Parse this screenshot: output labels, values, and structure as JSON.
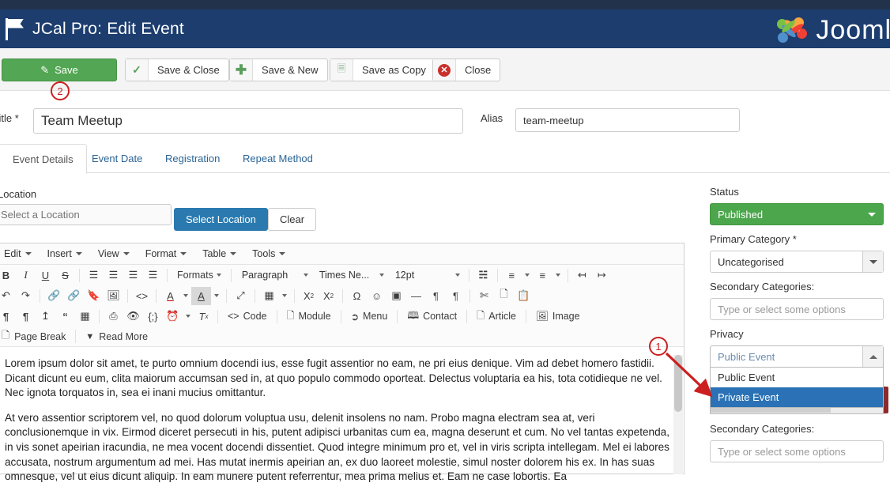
{
  "header": {
    "title": "JCal Pro: Edit Event",
    "flag_icon": "flag-icon",
    "brand": "Joomla",
    "brand_mark_icon": "joomla-logo-icon"
  },
  "toolbar": {
    "save_label": "Save",
    "save_icon": "pencil-square-icon",
    "save_close_label": "Save & Close",
    "save_close_icon": "check-icon",
    "save_new_label": "Save & New",
    "save_new_icon": "plus-icon",
    "save_copy_label": "Save as Copy",
    "save_copy_icon": "copy-icon",
    "close_label": "Close",
    "close_icon": "circle-x-icon"
  },
  "form": {
    "title_label": "Title *",
    "title_value": "Team Meetup",
    "alias_label": "Alias",
    "alias_value": "team-meetup"
  },
  "tabs": [
    {
      "label": "Event Details",
      "active": true
    },
    {
      "label": "Event Date",
      "active": false
    },
    {
      "label": "Registration",
      "active": false
    },
    {
      "label": "Repeat Method",
      "active": false
    }
  ],
  "location": {
    "label": "Location",
    "input_placeholder": "Select a Location",
    "select_button": "Select Location",
    "clear_button": "Clear"
  },
  "editor": {
    "menus": [
      "Edit",
      "Insert",
      "View",
      "Format",
      "Table",
      "Tools"
    ],
    "row1": {
      "bold": "B",
      "italic": "I",
      "underline": "U",
      "strikethrough": "S",
      "align_left_icon": "align-left-icon",
      "align_center_icon": "align-center-icon",
      "align_right_icon": "align-right-icon",
      "align_justify_icon": "align-justify-icon",
      "formats_label": "Formats",
      "paragraph_label": "Paragraph",
      "font_label": "Times Ne...",
      "fontsize_label": "12pt",
      "search_icon": "binoculars-icon",
      "bullist_icon": "bullet-list-icon",
      "numlist_icon": "numbered-list-icon",
      "outdent_icon": "outdent-icon",
      "indent_icon": "indent-icon"
    },
    "row2": {
      "undo_icon": "undo-icon",
      "redo_icon": "redo-icon",
      "link_icon": "link-icon",
      "unlink_icon": "unlink-icon",
      "anchor_icon": "anchor-bookmark-icon",
      "image_icon": "image-icon",
      "sourcecode_icon": "code-brackets-icon",
      "forecolor_icon": "text-color-icon",
      "backcolor_icon": "highlight-color-icon",
      "fullscreen_icon": "fullscreen-icon",
      "table_icon": "table-icon",
      "subscript_icon": "subscript-icon",
      "superscript_icon": "superscript-icon",
      "charmap_icon": "omega-charmap-icon",
      "emoticon_icon": "smiley-icon",
      "media_icon": "media-film-icon",
      "hr_icon": "horizontal-rule-icon",
      "ltr_icon": "ltr-icon",
      "rtl_icon": "rtl-icon",
      "cut_icon": "scissors-cut-icon",
      "copy_icon": "copy-icon",
      "paste_icon": "paste-clipboard-icon"
    },
    "row3": {
      "pilcrow_icon": "paragraph-mark-icon",
      "pilcrow2_icon": "paragraph-mark-alt-icon",
      "upload_icon": "upload-icon",
      "blockquote_icon": "blockquote-icon",
      "template_icon": "template-icon",
      "print_icon": "printer-icon",
      "preview_icon": "eye-preview-icon",
      "placeholder_icon": "code-snippet-icon",
      "insertdate_icon": "clock-icon",
      "removeformat_icon": "clear-formatting-icon",
      "code_label": "Code",
      "code_icon": "angle-brackets-icon",
      "module_label": "Module",
      "module_icon": "page-plus-icon",
      "menu_label": "Menu",
      "menu_icon": "share-arrow-icon",
      "contact_label": "Contact",
      "contact_icon": "contact-card-icon",
      "article_label": "Article",
      "article_icon": "page-plus-icon",
      "image_label": "Image",
      "image_icon": "picture-icon"
    },
    "row4": {
      "pagebreak_label": "Page Break",
      "pagebreak_icon": "page-break-icon",
      "readmore_label": "Read More",
      "readmore_icon": "chevron-down-icon"
    },
    "content": [
      "Lorem ipsum dolor sit amet, te purto omnium docendi ius, esse fugit assentior no eam, ne pri eius denique. Vim ad debet homero fastidii. Dicant dicunt eu eum, clita maiorum accumsan sed in, at quo populo commodo oporteat. Delectus voluptaria ea his, tota cotidieque ne vel. Nec ignota torquatos in, sea ei inani mucius omittantur.",
      "At vero assentior scriptorem vel, no quod dolorum voluptua usu, delenit insolens no nam. Probo magna electram sea at, veri conclusionemque in vix. Eirmod diceret persecuti in his, putent adipisci urbanitas cum ea, magna deserunt et cum. No vel tantas expetenda, in vis sonet apeirian iracundia, ne mea vocent docendi dissentiet. Quod integre minimum pro et, vel in viris scripta intellegam. Mel ei labores accusata, nostrum argumentum ad mei. Has mutat inermis apeirian an, ex duo laoreet molestie, simul noster dolorem his ex. In has suas omnesque, vel ut eius dicunt aliquip. In eam munere putent referrentur, mea prima melius et. Eam ne case lobortis. Ea"
    ]
  },
  "sidebar": {
    "status_label": "Status",
    "status_value": "Published",
    "primary_category_label": "Primary Category *",
    "primary_category_value": "Uncategorised",
    "secondary_categories_label": "Secondary Categories:",
    "secondary_categories_placeholder": "Type or select some options",
    "privacy_label": "Privacy",
    "privacy_value": "Public Event",
    "privacy_options": [
      "Public Event",
      "Private Event"
    ],
    "privacy_selected": "Private Event",
    "secondary_categories_label_2": "Secondary Categories:",
    "secondary_categories_placeholder_2": "Type or select some options"
  },
  "annotations": [
    {
      "id": "1",
      "label": "1"
    },
    {
      "id": "2",
      "label": "2"
    }
  ],
  "colors": {
    "header_bg": "#1c3d6e",
    "save_green": "#53a653",
    "status_green": "#4ca64c",
    "primary_blue": "#2a7ab0",
    "dropdown_selected": "#2a72b5",
    "annotation_red": "#cc1f1f"
  }
}
